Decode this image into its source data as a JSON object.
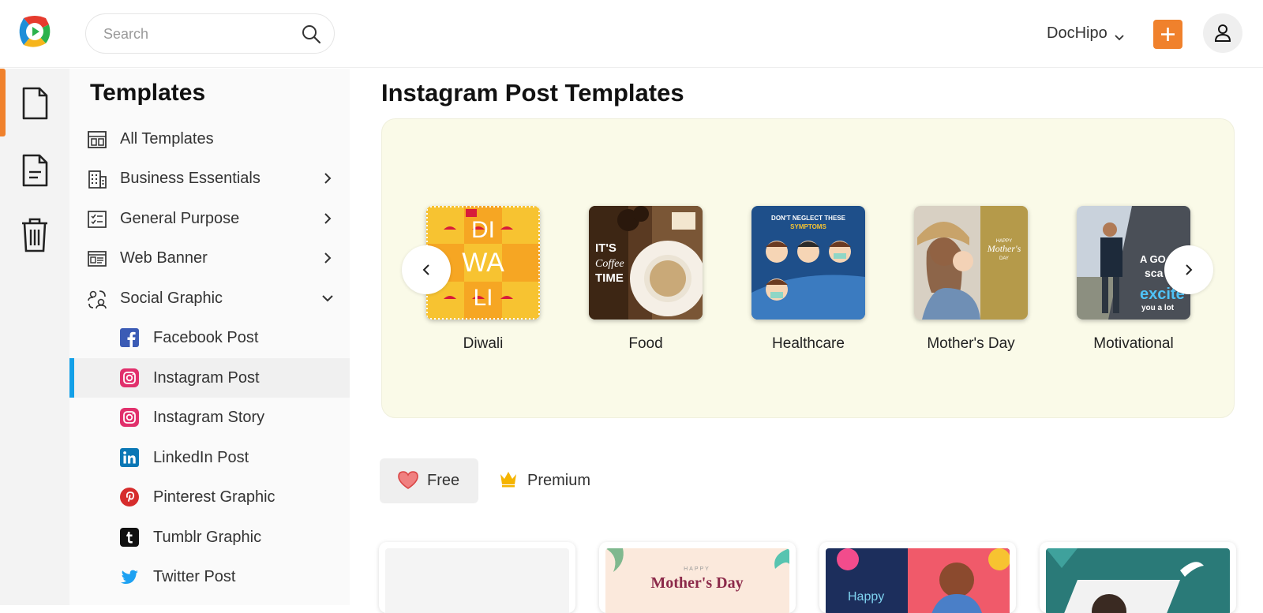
{
  "header": {
    "search_placeholder": "Search",
    "account_name": "DocHipo",
    "accent_color": "#f0812c"
  },
  "sidebar": {
    "title": "Templates",
    "items": [
      {
        "label": "All Templates",
        "icon": "template-grid-icon"
      },
      {
        "label": "Business Essentials",
        "icon": "building-icon"
      },
      {
        "label": "General Purpose",
        "icon": "checklist-icon"
      },
      {
        "label": "Web Banner",
        "icon": "web-banner-icon"
      },
      {
        "label": "Social Graphic",
        "icon": "social-users-icon"
      }
    ],
    "sub_items": [
      {
        "label": "Facebook Post",
        "icon": "facebook-icon"
      },
      {
        "label": "Instagram Post",
        "icon": "instagram-icon",
        "active": true
      },
      {
        "label": "Instagram Story",
        "icon": "instagram-icon"
      },
      {
        "label": "LinkedIn Post",
        "icon": "linkedin-icon"
      },
      {
        "label": "Pinterest Graphic",
        "icon": "pinterest-icon"
      },
      {
        "label": "Tumblr Graphic",
        "icon": "tumblr-icon"
      },
      {
        "label": "Twitter Post",
        "icon": "twitter-icon"
      }
    ]
  },
  "main": {
    "title": "Instagram Post Templates",
    "categories": [
      {
        "label": "Diwali",
        "thumb_text": [
          "DI",
          "WA",
          "LI"
        ]
      },
      {
        "label": "Food",
        "thumb_text": [
          "IT'S",
          "Coffee",
          "TIME"
        ]
      },
      {
        "label": "Healthcare",
        "thumb_text": [
          "DON'T NEGLECT THESE",
          "SYMPTOMS"
        ]
      },
      {
        "label": "Mother's Day",
        "thumb_text": [
          "HAPPY",
          "Mother's",
          "DAY"
        ]
      },
      {
        "label": "Motivational",
        "thumb_text": [
          "A GO",
          "sca",
          "excite",
          "you a lot"
        ]
      }
    ],
    "filters": {
      "free": "Free",
      "premium": "Premium"
    },
    "cards": [
      {
        "text": ""
      },
      {
        "text": [
          "HAPPY",
          "Mother's Day"
        ]
      },
      {
        "text": [
          "Happy"
        ]
      },
      {
        "text": []
      }
    ]
  }
}
